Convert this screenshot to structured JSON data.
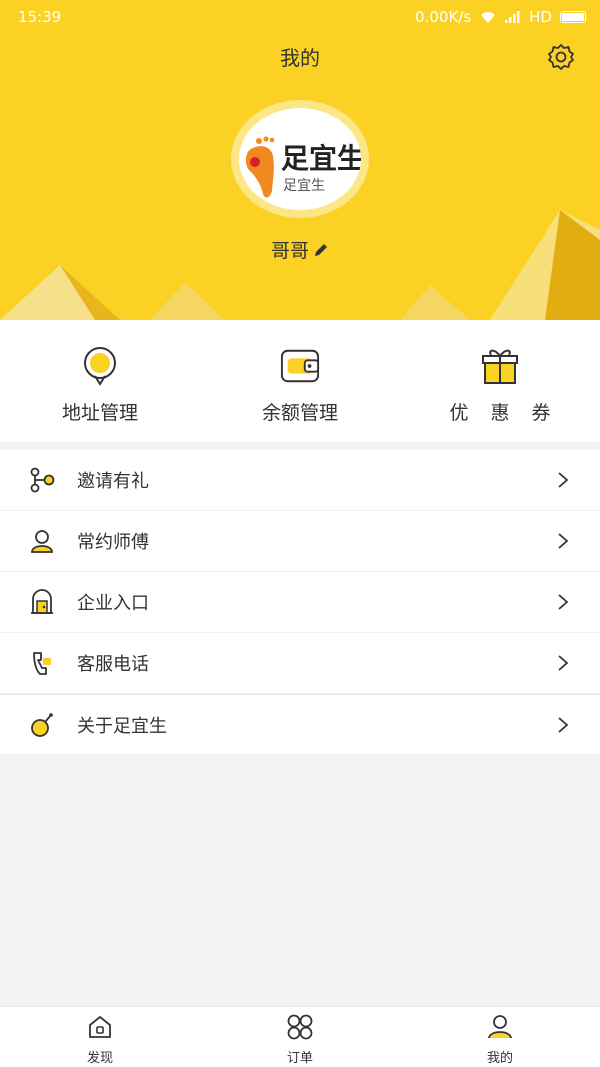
{
  "status_bar": {
    "time": "15:39",
    "network_speed": "0.00K/s",
    "network_type": "HD"
  },
  "header": {
    "title": "我的",
    "username": "哥哥",
    "avatar": {
      "logo_text": "足宜生",
      "logo_subtext": "足宜生"
    }
  },
  "quick_actions": [
    {
      "label": "地址管理",
      "icon": "location-bubble-icon"
    },
    {
      "label": "余额管理",
      "icon": "wallet-icon"
    },
    {
      "label": "优 惠 券",
      "icon": "gift-icon"
    }
  ],
  "menu": [
    {
      "label": "邀请有礼",
      "icon": "share-icon"
    },
    {
      "label": "常约师傅",
      "icon": "person-icon"
    },
    {
      "label": "企业入口",
      "icon": "enterprise-icon"
    },
    {
      "label": "客服电话",
      "icon": "phone-icon"
    },
    {
      "label": "关于足宜生",
      "icon": "about-icon"
    }
  ],
  "tabbar": [
    {
      "label": "发现",
      "icon": "home-icon"
    },
    {
      "label": "订单",
      "icon": "grid-icon"
    },
    {
      "label": "我的",
      "icon": "user-icon"
    }
  ],
  "colors": {
    "accent": "#fbd124",
    "accent_dark": "#e0ac0f",
    "text": "#333333",
    "background": "#f2f2f2"
  }
}
